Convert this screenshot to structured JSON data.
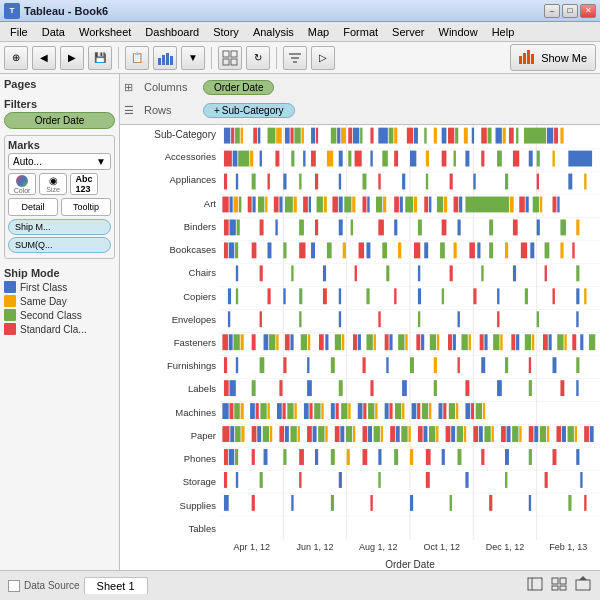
{
  "titleBar": {
    "title": "Tableau - Book6",
    "icon": "T",
    "minBtn": "–",
    "maxBtn": "□",
    "closeBtn": "✕"
  },
  "menuBar": {
    "items": [
      "File",
      "Data",
      "Worksheet",
      "Dashboard",
      "Story",
      "Analysis",
      "Map",
      "Format",
      "Server",
      "Window",
      "Help"
    ]
  },
  "toolbar": {
    "showMeLabel": "Show Me",
    "buttons": [
      "⊕",
      "←",
      "→",
      "💾",
      "📋",
      "📊",
      "📈",
      "📉",
      "⚙",
      "🔄",
      "≡"
    ]
  },
  "pages": {
    "title": "Pages"
  },
  "filters": {
    "title": "Filters",
    "items": [
      "Order Date"
    ]
  },
  "marks": {
    "title": "Marks",
    "dropdown": "Auto...",
    "colorLabel": "Color",
    "sizeLabel": "Size",
    "labelLabel": "Label",
    "detailLabel": "Detail",
    "tooltipLabel": "Tooltip",
    "pill1": "Ship M...",
    "pill2": "SUM(Q..."
  },
  "legend": {
    "title": "Ship Mode",
    "items": [
      {
        "label": "First Class",
        "color": "#4472c4"
      },
      {
        "label": "Same Day",
        "color": "#f4a500"
      },
      {
        "label": "Second Class",
        "color": "#70ad47"
      },
      {
        "label": "Standard Cla...",
        "color": "#e64646"
      }
    ]
  },
  "shelves": {
    "columns": "Columns",
    "rows": "Rows",
    "columnPill": "Order Date",
    "rowPill": "Sub-Category",
    "rowPillPlus": "+"
  },
  "chart": {
    "subCatHeader": "Sub-Category",
    "yLabels": [
      "Accessories",
      "Appliances",
      "Art",
      "Binders",
      "Bookcases",
      "Chairs",
      "Copiers",
      "Envelopes",
      "Fasteners",
      "Furnishings",
      "Labels",
      "Machines",
      "Paper",
      "Phones",
      "Storage",
      "Supplies",
      "Tables"
    ],
    "xLabels": [
      "Apr 1, 12",
      "Jun 1, 12",
      "Aug 1, 12",
      "Oct 1, 12",
      "Dec 1, 12",
      "Feb 1, 13"
    ],
    "xAxisTitle": "Order Date"
  },
  "statusBar": {
    "dataSourceLabel": "Data Source",
    "sheetLabel": "Sheet 1"
  }
}
